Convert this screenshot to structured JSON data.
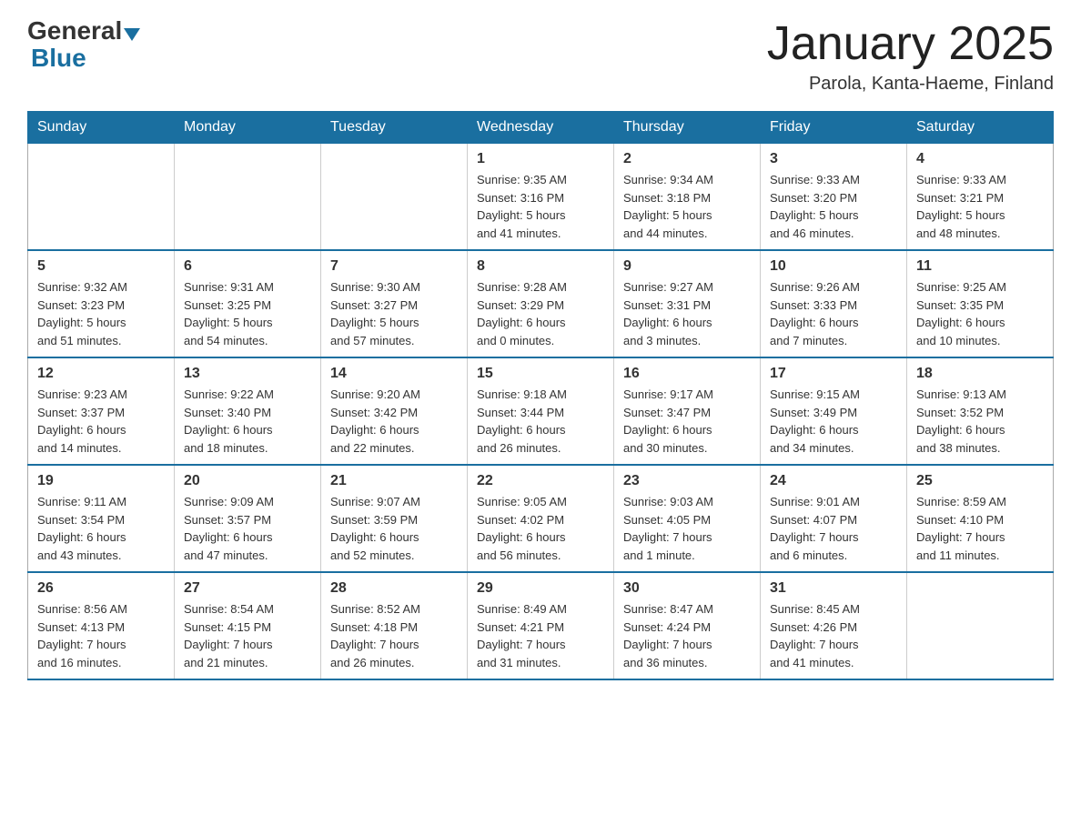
{
  "logo": {
    "general": "General",
    "blue": "Blue"
  },
  "title": "January 2025",
  "location": "Parola, Kanta-Haeme, Finland",
  "weekdays": [
    "Sunday",
    "Monday",
    "Tuesday",
    "Wednesday",
    "Thursday",
    "Friday",
    "Saturday"
  ],
  "weeks": [
    [
      {
        "day": "",
        "info": ""
      },
      {
        "day": "",
        "info": ""
      },
      {
        "day": "",
        "info": ""
      },
      {
        "day": "1",
        "info": "Sunrise: 9:35 AM\nSunset: 3:16 PM\nDaylight: 5 hours\nand 41 minutes."
      },
      {
        "day": "2",
        "info": "Sunrise: 9:34 AM\nSunset: 3:18 PM\nDaylight: 5 hours\nand 44 minutes."
      },
      {
        "day": "3",
        "info": "Sunrise: 9:33 AM\nSunset: 3:20 PM\nDaylight: 5 hours\nand 46 minutes."
      },
      {
        "day": "4",
        "info": "Sunrise: 9:33 AM\nSunset: 3:21 PM\nDaylight: 5 hours\nand 48 minutes."
      }
    ],
    [
      {
        "day": "5",
        "info": "Sunrise: 9:32 AM\nSunset: 3:23 PM\nDaylight: 5 hours\nand 51 minutes."
      },
      {
        "day": "6",
        "info": "Sunrise: 9:31 AM\nSunset: 3:25 PM\nDaylight: 5 hours\nand 54 minutes."
      },
      {
        "day": "7",
        "info": "Sunrise: 9:30 AM\nSunset: 3:27 PM\nDaylight: 5 hours\nand 57 minutes."
      },
      {
        "day": "8",
        "info": "Sunrise: 9:28 AM\nSunset: 3:29 PM\nDaylight: 6 hours\nand 0 minutes."
      },
      {
        "day": "9",
        "info": "Sunrise: 9:27 AM\nSunset: 3:31 PM\nDaylight: 6 hours\nand 3 minutes."
      },
      {
        "day": "10",
        "info": "Sunrise: 9:26 AM\nSunset: 3:33 PM\nDaylight: 6 hours\nand 7 minutes."
      },
      {
        "day": "11",
        "info": "Sunrise: 9:25 AM\nSunset: 3:35 PM\nDaylight: 6 hours\nand 10 minutes."
      }
    ],
    [
      {
        "day": "12",
        "info": "Sunrise: 9:23 AM\nSunset: 3:37 PM\nDaylight: 6 hours\nand 14 minutes."
      },
      {
        "day": "13",
        "info": "Sunrise: 9:22 AM\nSunset: 3:40 PM\nDaylight: 6 hours\nand 18 minutes."
      },
      {
        "day": "14",
        "info": "Sunrise: 9:20 AM\nSunset: 3:42 PM\nDaylight: 6 hours\nand 22 minutes."
      },
      {
        "day": "15",
        "info": "Sunrise: 9:18 AM\nSunset: 3:44 PM\nDaylight: 6 hours\nand 26 minutes."
      },
      {
        "day": "16",
        "info": "Sunrise: 9:17 AM\nSunset: 3:47 PM\nDaylight: 6 hours\nand 30 minutes."
      },
      {
        "day": "17",
        "info": "Sunrise: 9:15 AM\nSunset: 3:49 PM\nDaylight: 6 hours\nand 34 minutes."
      },
      {
        "day": "18",
        "info": "Sunrise: 9:13 AM\nSunset: 3:52 PM\nDaylight: 6 hours\nand 38 minutes."
      }
    ],
    [
      {
        "day": "19",
        "info": "Sunrise: 9:11 AM\nSunset: 3:54 PM\nDaylight: 6 hours\nand 43 minutes."
      },
      {
        "day": "20",
        "info": "Sunrise: 9:09 AM\nSunset: 3:57 PM\nDaylight: 6 hours\nand 47 minutes."
      },
      {
        "day": "21",
        "info": "Sunrise: 9:07 AM\nSunset: 3:59 PM\nDaylight: 6 hours\nand 52 minutes."
      },
      {
        "day": "22",
        "info": "Sunrise: 9:05 AM\nSunset: 4:02 PM\nDaylight: 6 hours\nand 56 minutes."
      },
      {
        "day": "23",
        "info": "Sunrise: 9:03 AM\nSunset: 4:05 PM\nDaylight: 7 hours\nand 1 minute."
      },
      {
        "day": "24",
        "info": "Sunrise: 9:01 AM\nSunset: 4:07 PM\nDaylight: 7 hours\nand 6 minutes."
      },
      {
        "day": "25",
        "info": "Sunrise: 8:59 AM\nSunset: 4:10 PM\nDaylight: 7 hours\nand 11 minutes."
      }
    ],
    [
      {
        "day": "26",
        "info": "Sunrise: 8:56 AM\nSunset: 4:13 PM\nDaylight: 7 hours\nand 16 minutes."
      },
      {
        "day": "27",
        "info": "Sunrise: 8:54 AM\nSunset: 4:15 PM\nDaylight: 7 hours\nand 21 minutes."
      },
      {
        "day": "28",
        "info": "Sunrise: 8:52 AM\nSunset: 4:18 PM\nDaylight: 7 hours\nand 26 minutes."
      },
      {
        "day": "29",
        "info": "Sunrise: 8:49 AM\nSunset: 4:21 PM\nDaylight: 7 hours\nand 31 minutes."
      },
      {
        "day": "30",
        "info": "Sunrise: 8:47 AM\nSunset: 4:24 PM\nDaylight: 7 hours\nand 36 minutes."
      },
      {
        "day": "31",
        "info": "Sunrise: 8:45 AM\nSunset: 4:26 PM\nDaylight: 7 hours\nand 41 minutes."
      },
      {
        "day": "",
        "info": ""
      }
    ]
  ]
}
